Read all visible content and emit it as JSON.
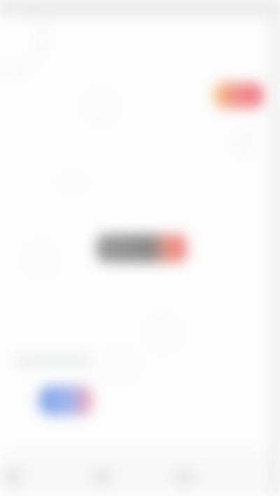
{
  "screen": {
    "content_legible": false,
    "colors": {
      "background": "#fdfdfd",
      "status_bar": "#e9e9e9",
      "top_pill_gradient": [
        "#f3c37a",
        "#ef8e8e",
        "#f07a8a"
      ],
      "middle_pill_gradient": [
        "#9e9e9e",
        "#8a8a8a",
        "#f09a8a",
        "#e37d7d"
      ],
      "bottom_pill_gradient": [
        "#7ea6e6",
        "#9fb6ef",
        "#f3a9b1"
      ]
    }
  }
}
